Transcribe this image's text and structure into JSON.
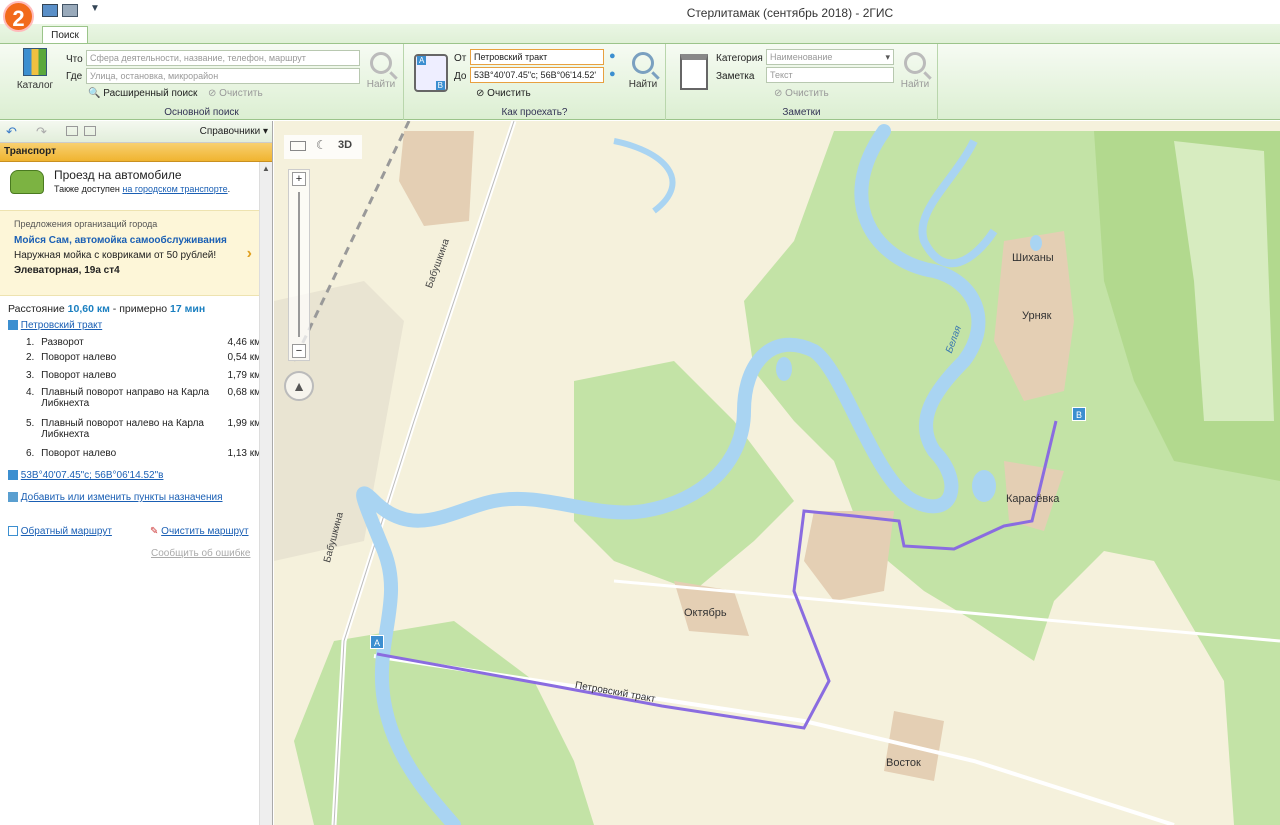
{
  "app": {
    "logo": "2",
    "window_title": "Стерлитамак (сентябрь 2018) - 2ГИС"
  },
  "tabs": {
    "search": "Поиск"
  },
  "ribbon": {
    "catalog_label": "Каталог",
    "what_label": "Что",
    "what_placeholder": "Сфера деятельности, название, телефон, маршрут",
    "where_label": "Где",
    "where_placeholder": "Улица, остановка, микрорайон",
    "find_label": "Найти",
    "advanced_search": "Расширенный поиск",
    "clear_label": "Очистить",
    "group1_caption": "Основной поиск",
    "from_label": "От",
    "from_value": "Петровский тракт",
    "to_label": "До",
    "to_value": "53В°40'07.45\"с; 56В°06'14.52'",
    "route_clear": "Очистить",
    "route_find": "Найти",
    "group2_caption": "Как проехать?",
    "category_label": "Категория",
    "category_placeholder": "Наименование",
    "note_label": "Заметка",
    "note_placeholder": "Текст",
    "notes_clear": "Очистить",
    "notes_find": "Найти",
    "group3_caption": "Заметки"
  },
  "panel": {
    "directories": "Справочники",
    "transport_header": "Транспорт",
    "car_title": "Проезд на автомобиле",
    "also_text": "Также доступен",
    "also_link": "на городском транспорте",
    "ad_caption": "Предложения организаций города",
    "ad_title": "Мойся Сам, автомойка самообслуживания",
    "ad_text": "Наружная мойка с ковриками от 50 рублей!",
    "ad_address": "Элеваторная, 19а ст4",
    "distance_label": "Расстояние",
    "distance_value": "10,60 км",
    "approx_label": "- примерно",
    "time_value": "17 мин",
    "start_point": "Петровский тракт",
    "steps": [
      {
        "n": "1.",
        "text": "Разворот",
        "dist": "4,46 км"
      },
      {
        "n": "2.",
        "text": "Поворот налево",
        "dist": "0,54 км"
      },
      {
        "n": "3.",
        "text": "Поворот налево",
        "dist": "1,79 км"
      },
      {
        "n": "4.",
        "text": "Плавный поворот направо на Карла Либкнехта",
        "dist": "0,68 км"
      },
      {
        "n": "5.",
        "text": "Плавный поворот налево на Карла Либкнехта",
        "dist": "1,99 км"
      },
      {
        "n": "6.",
        "text": "Поворот налево",
        "dist": "1,13 км"
      }
    ],
    "end_point": "53В°40'07.45\"с; 56В°06'14.52\"в",
    "add_points": "Добавить или изменить пункты назначения",
    "reverse_route": "Обратный маршрут",
    "clear_route": "Очистить маршрут",
    "report_error": "Сообщить об ошибке"
  },
  "map": {
    "mode_3d": "3D",
    "marker_a": "A",
    "marker_b": "B",
    "labels": {
      "babushkina1": "Бабушкина",
      "babushkina2": "Бабушкина",
      "belaya": "Белая",
      "shikhany": "Шиханы",
      "urnyak": "Урняк",
      "karasevka": "Карасёвка",
      "oktyabr": "Октябрь",
      "vostok": "Восток",
      "petrovsky": "Петровский тракт"
    },
    "colors": {
      "water": "#a9d4f2",
      "forest": "#bfe0a0",
      "route": "#8a6ce0",
      "settlement": "#e6d3bd"
    }
  }
}
